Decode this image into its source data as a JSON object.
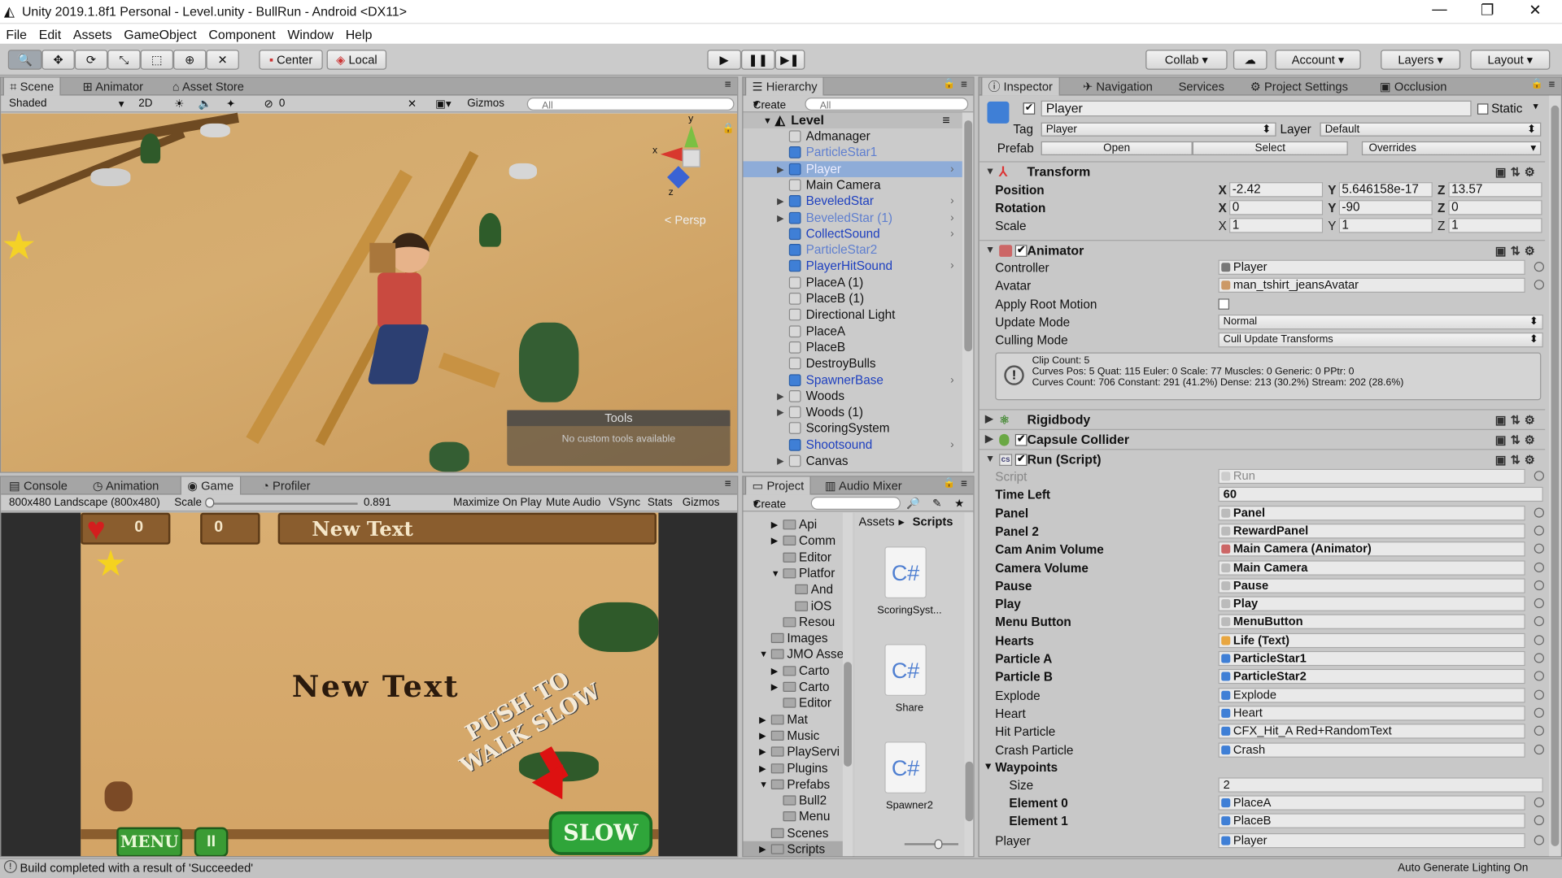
{
  "window": {
    "title": "Unity 2019.1.8f1 Personal - Level.unity - BullRun - Android <DX11>",
    "minimize": "—",
    "maximize": "❐",
    "close": "✕"
  },
  "menu": [
    "File",
    "Edit",
    "Assets",
    "GameObject",
    "Component",
    "Window",
    "Help"
  ],
  "toolbar": {
    "center": "Center",
    "local": "Local",
    "collab": "Collab ▾",
    "account": "Account",
    "layers": "Layers",
    "layout": "Layout"
  },
  "scene": {
    "tabs": [
      "Scene",
      "Animator",
      "Asset Store"
    ],
    "shading": "Shaded",
    "mode2d": "2D",
    "gizmos": "Gizmos",
    "search": "All",
    "persp": "< Persp",
    "tools_title": "Tools",
    "tools_msg": "No custom tools available",
    "axis_x": "x",
    "axis_y": "y",
    "axis_z": "z",
    "hidden_count": "0"
  },
  "hierarchy": {
    "tab": "Hierarchy",
    "create": "Create",
    "search": "All",
    "scene": "Level",
    "items": [
      {
        "name": "Admanager",
        "style": "normal",
        "arrow": "",
        "prefab": false
      },
      {
        "name": "ParticleStar1",
        "style": "blue2",
        "arrow": "",
        "prefab": true
      },
      {
        "name": "Player",
        "style": "sel",
        "arrow": "▶",
        "prefab": true
      },
      {
        "name": "Main Camera",
        "style": "normal",
        "arrow": "",
        "prefab": false
      },
      {
        "name": "BeveledStar",
        "style": "blue",
        "arrow": "▶",
        "prefab": true
      },
      {
        "name": "BeveledStar (1)",
        "style": "blue2",
        "arrow": "▶",
        "prefab": true
      },
      {
        "name": "CollectSound",
        "style": "blue",
        "arrow": "",
        "prefab": true
      },
      {
        "name": "ParticleStar2",
        "style": "blue2",
        "arrow": "",
        "prefab": true
      },
      {
        "name": "PlayerHitSound",
        "style": "blue",
        "arrow": "",
        "prefab": true
      },
      {
        "name": "PlaceA (1)",
        "style": "normal",
        "arrow": "",
        "prefab": false
      },
      {
        "name": "PlaceB (1)",
        "style": "normal",
        "arrow": "",
        "prefab": false
      },
      {
        "name": "Directional Light",
        "style": "normal",
        "arrow": "",
        "prefab": false
      },
      {
        "name": "PlaceA",
        "style": "normal",
        "arrow": "",
        "prefab": false
      },
      {
        "name": "PlaceB",
        "style": "normal",
        "arrow": "",
        "prefab": false
      },
      {
        "name": "DestroyBulls",
        "style": "normal",
        "arrow": "",
        "prefab": false
      },
      {
        "name": "SpawnerBase",
        "style": "blue",
        "arrow": "",
        "prefab": true
      },
      {
        "name": "Woods",
        "style": "normal",
        "arrow": "▶",
        "prefab": false
      },
      {
        "name": "Woods (1)",
        "style": "normal",
        "arrow": "▶",
        "prefab": false
      },
      {
        "name": "ScoringSystem",
        "style": "normal",
        "arrow": "",
        "prefab": false
      },
      {
        "name": "Shootsound",
        "style": "blue",
        "arrow": "",
        "prefab": true
      },
      {
        "name": "Canvas",
        "style": "normal",
        "arrow": "▶",
        "prefab": false
      }
    ]
  },
  "game": {
    "tabs": [
      "Console",
      "Animation",
      "Game",
      "Profiler"
    ],
    "resolution": "800x480 Landscape (800x480)",
    "scale_label": "Scale",
    "scale_value": "0.891",
    "buttons": [
      "Maximize On Play",
      "Mute Audio",
      "VSync",
      "Stats",
      "Gizmos"
    ],
    "hud_hearts": "0",
    "hud_stars": "0",
    "hud_text": "New Text",
    "center_text": "New Text",
    "hint": "PUSH TO WALK SLOW",
    "menu_btn": "MENU",
    "pause_btn": "II",
    "slow_btn": "SLOW"
  },
  "project": {
    "tabs": [
      "Project",
      "Audio Mixer"
    ],
    "create": "Create",
    "folders": [
      {
        "name": "Api",
        "indent": 2,
        "arrow": "▶"
      },
      {
        "name": "Comm",
        "indent": 2,
        "arrow": "▶"
      },
      {
        "name": "Editor",
        "indent": 2,
        "arrow": ""
      },
      {
        "name": "Platfor",
        "indent": 2,
        "arrow": "▼"
      },
      {
        "name": "And",
        "indent": 3,
        "arrow": ""
      },
      {
        "name": "iOS",
        "indent": 3,
        "arrow": ""
      },
      {
        "name": "Resou",
        "indent": 2,
        "arrow": ""
      },
      {
        "name": "Images",
        "indent": 1,
        "arrow": ""
      },
      {
        "name": "JMO Asse",
        "indent": 1,
        "arrow": "▼"
      },
      {
        "name": "Carto",
        "indent": 2,
        "arrow": "▶"
      },
      {
        "name": "Carto",
        "indent": 2,
        "arrow": "▶"
      },
      {
        "name": "Editor",
        "indent": 2,
        "arrow": ""
      },
      {
        "name": "Mat",
        "indent": 1,
        "arrow": "▶"
      },
      {
        "name": "Music",
        "indent": 1,
        "arrow": "▶"
      },
      {
        "name": "PlayServi",
        "indent": 1,
        "arrow": "▶"
      },
      {
        "name": "Plugins",
        "indent": 1,
        "arrow": "▶"
      },
      {
        "name": "Prefabs",
        "indent": 1,
        "arrow": "▼"
      },
      {
        "name": "Bull2",
        "indent": 2,
        "arrow": ""
      },
      {
        "name": "Menu",
        "indent": 2,
        "arrow": ""
      },
      {
        "name": "Scenes",
        "indent": 1,
        "arrow": ""
      },
      {
        "name": "Scripts",
        "indent": 1,
        "arrow": "▶"
      }
    ],
    "breadcrumb": [
      "Assets",
      "Scripts"
    ],
    "files": [
      "ScoringSyst...",
      "Share",
      "Spawner2"
    ],
    "file_icon": "C#"
  },
  "inspector": {
    "tabs": [
      "Inspector",
      "Navigation",
      "Services",
      "Project Settings",
      "Occlusion"
    ],
    "name": "Player",
    "static": "Static",
    "tag_label": "Tag",
    "tag": "Player",
    "layer_label": "Layer",
    "layer": "Default",
    "prefab_label": "Prefab",
    "open": "Open",
    "select": "Select",
    "overrides": "Overrides",
    "transform": {
      "title": "Transform",
      "position": {
        "label": "Position",
        "x": "-2.42",
        "y": "5.646158e-17",
        "z": "13.57"
      },
      "rotation": {
        "label": "Rotation",
        "x": "0",
        "y": "-90",
        "z": "0"
      },
      "scale": {
        "label": "Scale",
        "x": "1",
        "y": "1",
        "z": "1"
      }
    },
    "animator": {
      "title": "Animator",
      "fields": [
        {
          "k": "Controller",
          "v": "Player"
        },
        {
          "k": "Avatar",
          "v": "man_tshirt_jeansAvatar"
        },
        {
          "k": "Apply Root Motion",
          "v": ""
        },
        {
          "k": "Update Mode",
          "v": "Normal"
        },
        {
          "k": "Culling Mode",
          "v": "Cull Update Transforms"
        }
      ],
      "info": [
        "Clip Count: 5",
        "Curves Pos: 5 Quat: 115 Euler: 0 Scale: 77 Muscles: 0 Generic: 0 PPtr: 0",
        "Curves Count: 706 Constant: 291 (41.2%) Dense: 213 (30.2%) Stream: 202 (28.6%)"
      ]
    },
    "rigidbody": "Rigidbody",
    "capsule": "Capsule Collider",
    "run": {
      "title": "Run (Script)",
      "fields": [
        {
          "k": "Script",
          "v": "Run",
          "bold": false,
          "dim": true
        },
        {
          "k": "Time Left",
          "v": "60",
          "bold": true
        },
        {
          "k": "Panel",
          "v": "Panel",
          "bold": true
        },
        {
          "k": "Panel 2",
          "v": "RewardPanel",
          "bold": true
        },
        {
          "k": "Cam Anim Volume",
          "v": "Main Camera (Animator)",
          "bold": true
        },
        {
          "k": "Camera Volume",
          "v": "Main Camera",
          "bold": true
        },
        {
          "k": "Pause",
          "v": "Pause",
          "bold": true
        },
        {
          "k": "Play",
          "v": "Play",
          "bold": true
        },
        {
          "k": "Menu Button",
          "v": "MenuButton",
          "bold": true
        },
        {
          "k": "Hearts",
          "v": "Life (Text)",
          "bold": true
        },
        {
          "k": "Particle A",
          "v": "ParticleStar1",
          "bold": true
        },
        {
          "k": "Particle B",
          "v": "ParticleStar2",
          "bold": true
        },
        {
          "k": "Explode",
          "v": "Explode",
          "bold": false
        },
        {
          "k": "Heart",
          "v": "Heart",
          "bold": false
        },
        {
          "k": "Hit Particle",
          "v": "CFX_Hit_A Red+RandomText",
          "bold": false
        },
        {
          "k": "Crash Particle",
          "v": "Crash",
          "bold": false
        }
      ],
      "waypoints": "Waypoints",
      "size_label": "Size",
      "size": "2",
      "el0_label": "Element 0",
      "el0": "PlaceA",
      "el1_label": "Element 1",
      "el1": "PlaceB",
      "player_label": "Player",
      "player": "Player"
    }
  },
  "status": {
    "message": "Build completed with a result of 'Succeeded'",
    "right": "Auto Generate Lighting On"
  },
  "colors": {
    "accent": "#3d6fd6",
    "selection": "#8eacd8",
    "panel": "#c8c8c8"
  }
}
